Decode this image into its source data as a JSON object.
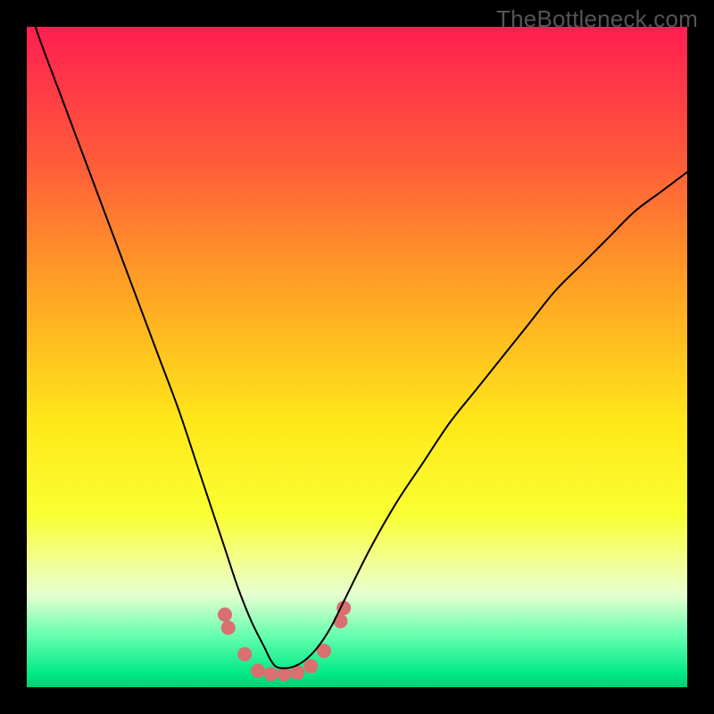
{
  "watermark": "TheBottleneck.com",
  "chart_data": {
    "type": "line",
    "title": "",
    "xlabel": "",
    "ylabel": "",
    "xlim": [
      0,
      100
    ],
    "ylim": [
      0,
      100
    ],
    "gradient_stops": [
      {
        "offset": 0.0,
        "color": "#ff1e52"
      },
      {
        "offset": 0.2,
        "color": "#ff5a3a"
      },
      {
        "offset": 0.4,
        "color": "#ffa424"
      },
      {
        "offset": 0.6,
        "color": "#ffe81a"
      },
      {
        "offset": 0.74,
        "color": "#f9ff32"
      },
      {
        "offset": 0.82,
        "color": "#f0ffa0"
      },
      {
        "offset": 0.86,
        "color": "#e6ffd0"
      },
      {
        "offset": 0.92,
        "color": "#69ffb0"
      },
      {
        "offset": 0.98,
        "color": "#00e986"
      },
      {
        "offset": 1.0,
        "color": "#00d070"
      }
    ],
    "series": [
      {
        "name": "curve",
        "stroke": "#000000",
        "x": [
          0,
          2,
          5,
          8,
          11,
          14,
          17,
          20,
          23,
          26,
          28,
          30,
          32,
          34,
          36,
          37,
          38,
          40,
          42,
          44,
          46,
          48,
          52,
          56,
          60,
          64,
          68,
          72,
          76,
          80,
          84,
          88,
          92,
          96,
          100
        ],
        "y": [
          104,
          98,
          90,
          82,
          74,
          66,
          58,
          50,
          42,
          33,
          27,
          21,
          15,
          10,
          6,
          4,
          3,
          3,
          4,
          6,
          9,
          13,
          21,
          28,
          34,
          40,
          45,
          50,
          55,
          60,
          64,
          68,
          72,
          75,
          78
        ]
      }
    ],
    "marker_cluster": {
      "color": "#d87070",
      "radius": 8,
      "points": [
        {
          "x": 30,
          "y": 11
        },
        {
          "x": 30.5,
          "y": 9
        },
        {
          "x": 33,
          "y": 5
        },
        {
          "x": 35,
          "y": 2.5
        },
        {
          "x": 37,
          "y": 2
        },
        {
          "x": 39,
          "y": 2
        },
        {
          "x": 41,
          "y": 2.2
        },
        {
          "x": 43,
          "y": 3.2
        },
        {
          "x": 45,
          "y": 5.5
        },
        {
          "x": 47.5,
          "y": 10
        },
        {
          "x": 48,
          "y": 12
        }
      ]
    }
  }
}
